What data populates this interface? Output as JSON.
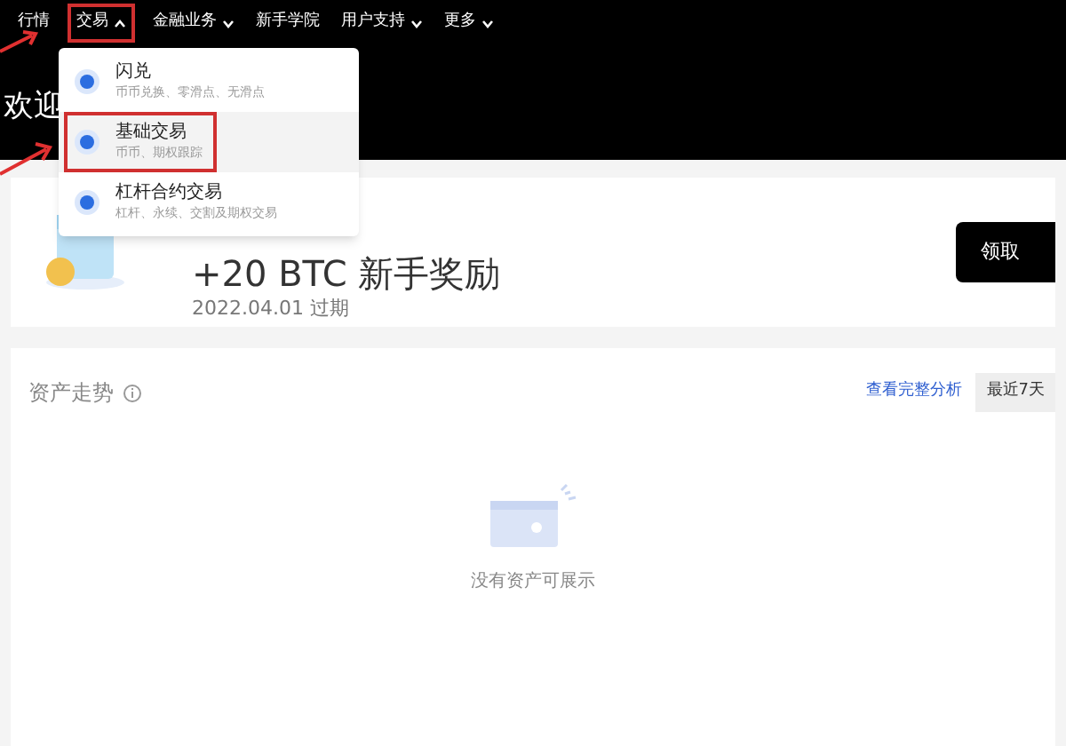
{
  "nav": {
    "items": [
      {
        "label": "行情",
        "has_menu": false,
        "expanded": false
      },
      {
        "label": "交易",
        "has_menu": true,
        "expanded": true
      },
      {
        "label": "金融业务",
        "has_menu": true,
        "expanded": false
      },
      {
        "label": "新手学院",
        "has_menu": false,
        "expanded": false
      },
      {
        "label": "用户支持",
        "has_menu": true,
        "expanded": false
      },
      {
        "label": "更多",
        "has_menu": true,
        "expanded": false
      }
    ]
  },
  "dropdown": {
    "items": [
      {
        "title": "闪兑",
        "subtitle": "币币兑换、零滑点、无滑点",
        "selected": false
      },
      {
        "title": "基础交易",
        "subtitle": "币币、期权跟踪",
        "selected": true
      },
      {
        "title": "杠杆合约交易",
        "subtitle": "杠杆、永续、交割及期权交易",
        "selected": false
      }
    ]
  },
  "welcome": {
    "heading": "欢迎"
  },
  "reward": {
    "title": "+20 BTC 新手奖励",
    "expiry": "2022.04.01 过期",
    "button": "领取"
  },
  "assets": {
    "title": "资产走势",
    "link": "查看完整分析",
    "range": "最近7天",
    "empty": "没有资产可展示"
  }
}
